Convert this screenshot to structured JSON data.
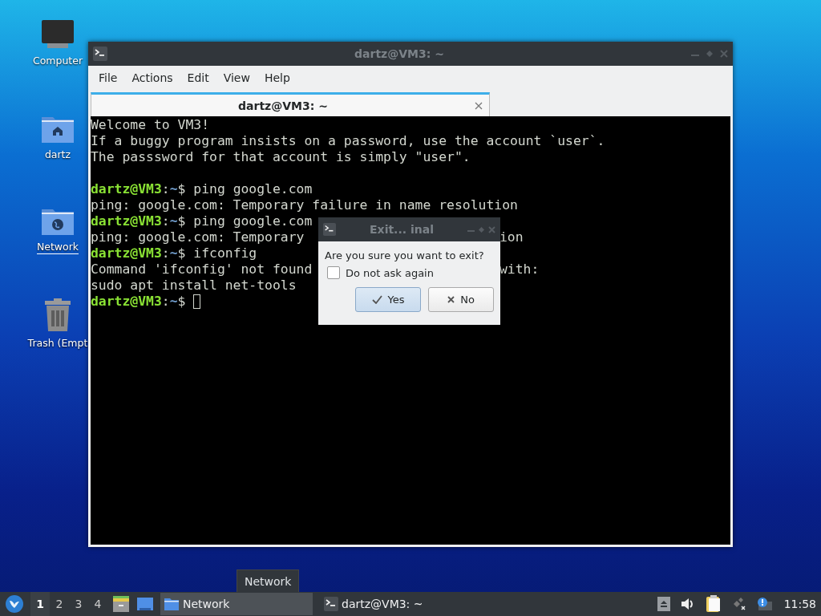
{
  "desktop_icons": [
    {
      "label": "Computer",
      "kind": "computer",
      "hovered": false
    },
    {
      "label": "dartz",
      "kind": "home",
      "hovered": false
    },
    {
      "label": "Network",
      "kind": "network",
      "hovered": true
    },
    {
      "label": "Trash (Empt",
      "kind": "trash",
      "hovered": false
    }
  ],
  "terminal_window": {
    "title": "dartz@VM3: ~",
    "menu": [
      "File",
      "Actions",
      "Edit",
      "View",
      "Help"
    ],
    "tabs": [
      {
        "label": "dartz@VM3: ~",
        "selected": true
      }
    ],
    "cursor_visible": true,
    "lines": [
      {
        "kind": "text",
        "parts": [
          {
            "kind": "plain",
            "text": "Welcome to VM3!"
          }
        ]
      },
      {
        "kind": "text",
        "parts": [
          {
            "kind": "plain",
            "text": "If a buggy program insists on a password, use the account `user`."
          }
        ]
      },
      {
        "kind": "text",
        "parts": [
          {
            "kind": "plain",
            "text": "The passsword for that account is simply \"user\"."
          }
        ]
      },
      {
        "kind": "blank"
      },
      {
        "kind": "text",
        "parts": [
          {
            "kind": "user",
            "text": "dartz@VM3"
          },
          {
            "kind": "plain",
            "text": ":"
          },
          {
            "kind": "path",
            "text": "~"
          },
          {
            "kind": "plain",
            "text": "$ ping google.com"
          }
        ]
      },
      {
        "kind": "text",
        "parts": [
          {
            "kind": "plain",
            "text": "ping: google.com: Temporary failure in name resolution"
          }
        ]
      },
      {
        "kind": "text",
        "parts": [
          {
            "kind": "user",
            "text": "dartz@VM3"
          },
          {
            "kind": "plain",
            "text": ":"
          },
          {
            "kind": "path",
            "text": "~"
          },
          {
            "kind": "plain",
            "text": "$ ping google.com"
          }
        ]
      },
      {
        "kind": "text",
        "parts": [
          {
            "kind": "plain",
            "text": "ping: google.com: Temporary"
          }
        ],
        "after_dialog": "ion"
      },
      {
        "kind": "text",
        "parts": [
          {
            "kind": "user",
            "text": "dartz@VM3"
          },
          {
            "kind": "plain",
            "text": ":"
          },
          {
            "kind": "path",
            "text": "~"
          },
          {
            "kind": "plain",
            "text": "$ ifconfig"
          }
        ]
      },
      {
        "kind": "text",
        "parts": [
          {
            "kind": "plain",
            "text": "Command 'ifconfig' not found"
          }
        ],
        "after_dialog": "with:"
      },
      {
        "kind": "text",
        "parts": [
          {
            "kind": "plain",
            "text": "sudo apt install net-tools"
          }
        ]
      },
      {
        "kind": "text",
        "parts": [
          {
            "kind": "user",
            "text": "dartz@VM3"
          },
          {
            "kind": "plain",
            "text": ":"
          },
          {
            "kind": "path",
            "text": "~"
          },
          {
            "kind": "plain",
            "text": "$ "
          }
        ]
      }
    ]
  },
  "dialog": {
    "title": "Exit... inal",
    "message": "Are you sure you want to exit?",
    "checkbox": {
      "label": "Do not ask again",
      "checked": false
    },
    "buttons": [
      {
        "label": "Yes",
        "kind": "yes",
        "default": true
      },
      {
        "label": "No",
        "kind": "no",
        "default": false
      }
    ]
  },
  "tooltip": "Network",
  "taskbar": {
    "workspaces": [
      {
        "label": "1",
        "selected": true
      },
      {
        "label": "2",
        "selected": false
      },
      {
        "label": "3",
        "selected": false
      },
      {
        "label": "4",
        "selected": false
      }
    ],
    "launchers": [
      {
        "kind": "file-manager"
      },
      {
        "kind": "desktop"
      }
    ],
    "tasks": [
      {
        "label": "Network",
        "kind": "folder",
        "selected": true
      },
      {
        "label": "dartz@VM3: ~",
        "kind": "terminal",
        "selected": false
      }
    ],
    "tray": [
      {
        "kind": "eject"
      },
      {
        "kind": "volume"
      },
      {
        "kind": "clipboard"
      },
      {
        "kind": "network"
      },
      {
        "kind": "update"
      }
    ],
    "clock": "11:58"
  }
}
